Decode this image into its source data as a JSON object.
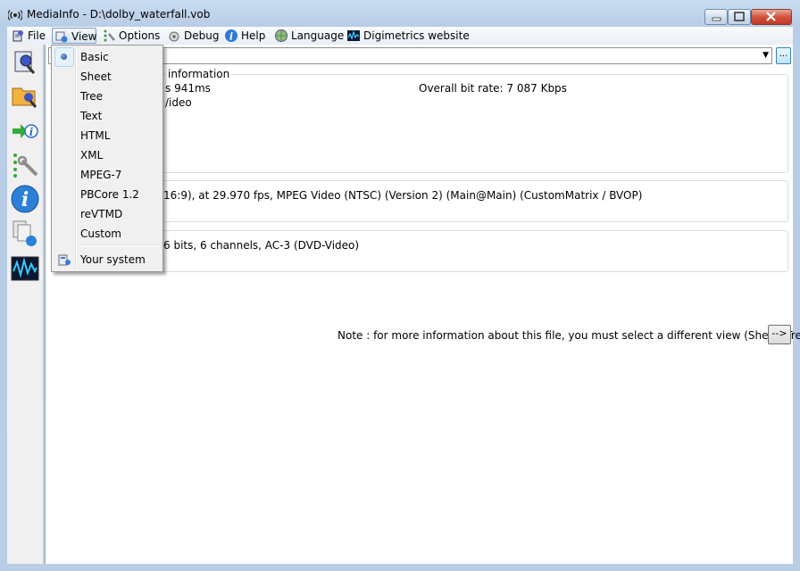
{
  "window": {
    "title": "MediaInfo - D:\\dolby_waterfall.vob"
  },
  "menubar": {
    "items": [
      {
        "label": "File",
        "icon": "file-icon"
      },
      {
        "label": "View",
        "icon": "view-icon"
      },
      {
        "label": "Options",
        "icon": "options-icon"
      },
      {
        "label": "Debug",
        "icon": "debug-icon"
      },
      {
        "label": "Help",
        "icon": "help-icon"
      },
      {
        "label": "Language",
        "icon": "language-icon"
      },
      {
        "label": "Digimetrics website",
        "icon": "digimetrics-icon"
      }
    ]
  },
  "view_menu": {
    "items": [
      "Basic",
      "Sheet",
      "Tree",
      "Text",
      "HTML",
      "XML",
      "MPEG-7",
      "PBCore 1.2",
      "reVTMD",
      "Custom"
    ],
    "selected": "Basic",
    "extra": "Your system"
  },
  "toolbar": {
    "buttons": [
      "open-file-icon",
      "open-folder-icon",
      "export-icon",
      "preferences-icon",
      "about-icon",
      "knowledge-base-icon",
      "digimetrics-logo-icon"
    ]
  },
  "content": {
    "combo_arrow": "▼",
    "browse_label": "...",
    "general": {
      "title": "information",
      "duration_fragment": "s 941ms",
      "bitrate": "Overall bit rate: 7 087 Kbps",
      "format_fragment": "/ideo"
    },
    "video_line": "16:9), at 29.970 fps, MPEG Video (NTSC) (Version 2) (Main@Main) (CustomMatrix / BVOP)",
    "audio_line": "6 bits, 6 channels, AC-3 (DVD-Video)",
    "note": "Note : for more information about this file, you must select a different view (Sheet, Tree...)",
    "note_button": "-->"
  },
  "colors": {
    "window_frame": "#b9cde4",
    "menu_background": "#f0f0f0",
    "selected_bullet": "#1e3f8a"
  }
}
